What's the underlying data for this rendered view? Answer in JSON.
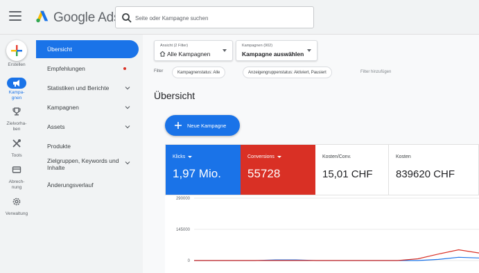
{
  "app": {
    "brand": "Google Ads",
    "search_placeholder": "Seite oder Kampagne suchen"
  },
  "rail": {
    "items": [
      {
        "label": "Erstellen",
        "icon": "plus-icon"
      },
      {
        "label": "Kampa-\ngnen",
        "icon": "megaphone-icon",
        "active": true
      },
      {
        "label": "Zielvorha-\nben",
        "icon": "trophy-icon"
      },
      {
        "label": "Tools",
        "icon": "tools-icon"
      },
      {
        "label": "Abrech-\nnung",
        "icon": "credit-card-icon"
      },
      {
        "label": "Verwaltung",
        "icon": "gear-icon"
      }
    ]
  },
  "nav": {
    "items": [
      {
        "label": "Übersicht",
        "active": true
      },
      {
        "label": "Empfehlungen",
        "dot": true
      },
      {
        "label": "Statistiken und Berichte",
        "chevron": true
      },
      {
        "label": "Kampagnen",
        "chevron": true
      },
      {
        "label": "Assets",
        "chevron": true
      },
      {
        "label": "Produkte"
      },
      {
        "label": "Zielgruppen, Keywords und Inhalte",
        "chevron": true
      },
      {
        "label": "Änderungsverlauf"
      }
    ]
  },
  "selectors": {
    "view": {
      "small": "Ansicht (2 Filter)",
      "big": "Alle Kampagnen"
    },
    "campaigns": {
      "small": "Kampagnen (902)",
      "big": "Kampagne auswählen"
    }
  },
  "filters": {
    "label": "Filter",
    "chips": [
      "Kampagnenstatus: Alle",
      "Anzeigengruppenstatus: Aktiviert, Pausiert"
    ],
    "add": "Filter hinzufügen"
  },
  "page": {
    "title": "Übersicht",
    "new_campaign": "Neue Kampagne"
  },
  "scorecards": [
    {
      "name": "Klicks",
      "value": "1,97 Mio.",
      "color": "#1a73e8",
      "selected": true
    },
    {
      "name": "Conversions",
      "value": "55728",
      "color": "#d93025",
      "selected": true
    },
    {
      "name": "Kosten/Conv.",
      "value": "15,01 CHF",
      "selected": false
    },
    {
      "name": "Kosten",
      "value": "839620 CHF",
      "selected": false
    }
  ],
  "colors": {
    "accent": "#1a73e8",
    "conversions": "#d93025"
  },
  "chart_data": {
    "type": "line",
    "y_ticks": [
      "290000",
      "145000",
      "0"
    ],
    "ylim": [
      0,
      290000
    ],
    "x": [
      0,
      1,
      2,
      3,
      4,
      5,
      6,
      7,
      8,
      9,
      10,
      11,
      12,
      13,
      14
    ],
    "series": [
      {
        "name": "Klicks",
        "color": "#1a73e8",
        "values": [
          0,
          0,
          0,
          0,
          3000,
          3000,
          0,
          0,
          0,
          0,
          0,
          0,
          5000,
          15000,
          12000
        ]
      },
      {
        "name": "Conversions",
        "color": "#d93025",
        "values": [
          0,
          0,
          0,
          0,
          0,
          0,
          0,
          0,
          0,
          0,
          0,
          8000,
          30000,
          50000,
          35000
        ]
      }
    ]
  }
}
